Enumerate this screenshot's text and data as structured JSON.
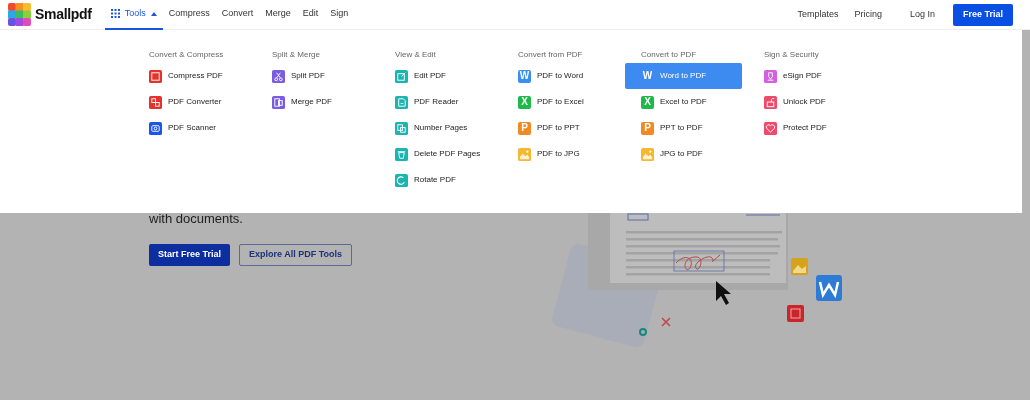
{
  "header": {
    "brand": "Smallpdf",
    "nav": [
      {
        "label": "Tools",
        "selected": true,
        "expanded": true
      },
      {
        "label": "Compress",
        "selected": false
      },
      {
        "label": "Convert",
        "selected": false
      },
      {
        "label": "Merge",
        "selected": false
      },
      {
        "label": "Edit",
        "selected": false
      },
      {
        "label": "Sign",
        "selected": false
      }
    ],
    "right_links": [
      "Templates",
      "Pricing",
      "Log In"
    ],
    "cta": "Free Trial"
  },
  "menu": {
    "columns": [
      {
        "title": "Convert & Compress",
        "items": [
          {
            "label": "Compress PDF",
            "kind": "compress",
            "color": "#e5322d",
            "selected": false
          },
          {
            "label": "PDF Converter",
            "kind": "convert",
            "color": "#e5322d",
            "selected": false
          },
          {
            "label": "PDF Scanner",
            "kind": "scan",
            "color": "#1a56e8",
            "selected": false
          }
        ]
      },
      {
        "title": "Split & Merge",
        "items": [
          {
            "label": "Split PDF",
            "kind": "split",
            "color": "#7a5ce0",
            "selected": false
          },
          {
            "label": "Merge PDF",
            "kind": "merge",
            "color": "#7a5ce0",
            "selected": false
          }
        ]
      },
      {
        "title": "View & Edit",
        "items": [
          {
            "label": "Edit PDF",
            "kind": "edit",
            "color": "#19b5b0",
            "selected": false
          },
          {
            "label": "PDF Reader",
            "kind": "reader",
            "color": "#19b5b0",
            "selected": false
          },
          {
            "label": "Number Pages",
            "kind": "number",
            "color": "#19b5b0",
            "selected": false
          },
          {
            "label": "Delete PDF Pages",
            "kind": "delete",
            "color": "#19b5b0",
            "selected": false
          },
          {
            "label": "Rotate PDF",
            "kind": "rotate",
            "color": "#19b5b0",
            "selected": false
          }
        ]
      },
      {
        "title": "Convert from PDF",
        "items": [
          {
            "label": "PDF to Word",
            "kind": "letter",
            "glyph": "W",
            "color": "#3a8ef0",
            "selected": false
          },
          {
            "label": "PDF to Excel",
            "kind": "letter",
            "glyph": "X",
            "color": "#1fb84a",
            "selected": false
          },
          {
            "label": "PDF to PPT",
            "kind": "letter",
            "glyph": "P",
            "color": "#f08a24",
            "selected": false
          },
          {
            "label": "PDF to JPG",
            "kind": "jpg",
            "color": "#f5b82e",
            "selected": false
          }
        ]
      },
      {
        "title": "Convert to PDF",
        "items": [
          {
            "label": "Word to PDF",
            "kind": "letter",
            "glyph": "W",
            "selected": true
          },
          {
            "label": "Excel to PDF",
            "kind": "letter",
            "glyph": "X",
            "color": "#1fb84a",
            "selected": false
          },
          {
            "label": "PPT to PDF",
            "kind": "letter",
            "glyph": "P",
            "color": "#f08a24",
            "selected": false
          },
          {
            "label": "JPG to PDF",
            "kind": "jpg",
            "color": "#f5b82e",
            "selected": false
          }
        ]
      },
      {
        "title": "Sign & Security",
        "items": [
          {
            "label": "eSign PDF",
            "kind": "esign",
            "color": "#d45fe0",
            "selected": false
          },
          {
            "label": "Unlock PDF",
            "kind": "unlock",
            "color": "#ee4a6a",
            "selected": false
          },
          {
            "label": "Protect PDF",
            "kind": "protect",
            "color": "#ee4a6a",
            "selected": false
          }
        ]
      }
    ]
  },
  "hero": {
    "text": "with documents.",
    "buttons": [
      {
        "label": "Start Free Trial",
        "kind": "primary"
      },
      {
        "label": "Explore All PDF Tools",
        "kind": "outline"
      }
    ]
  }
}
